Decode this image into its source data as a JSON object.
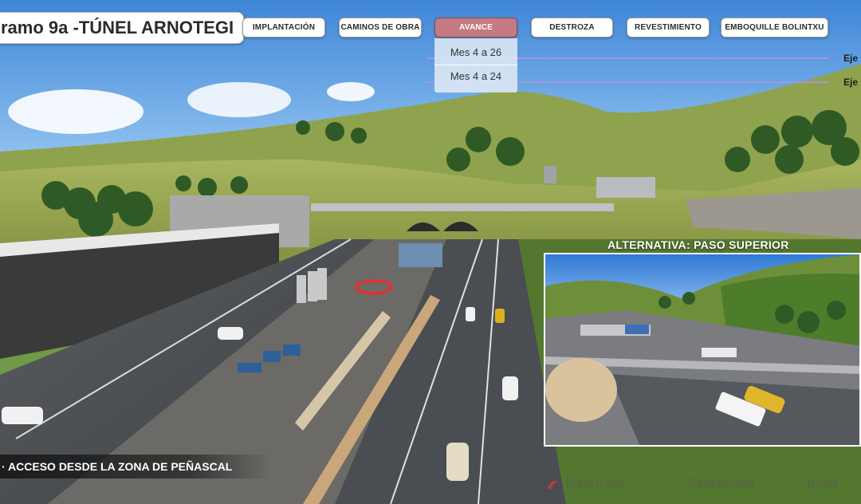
{
  "title": "ramo 9a -TÚNEL ARNOTEGI",
  "nav": {
    "buttons": [
      {
        "label": "IMPLANTACIÓN",
        "active": false
      },
      {
        "label": "CAMINOS DE OBRA",
        "active": false
      },
      {
        "label": "AVANCE",
        "active": true
      },
      {
        "label": "DESTROZA",
        "active": false
      },
      {
        "label": "REVESTIMIENTO",
        "active": false
      },
      {
        "label": "EMBOQUILLE BOLINTXU",
        "active": false
      }
    ]
  },
  "dropdown": {
    "items": [
      "Mes 4 a 26",
      "Mes 4 a 24"
    ]
  },
  "eje_labels": [
    "Eje",
    "Eje"
  ],
  "captions": {
    "alternative": "ALTERNATIVA: PASO SUPERIOR",
    "bottom": "· ACCESO DESDE LA ZONA DE PEÑASCAL"
  },
  "logos": {
    "first": "Viaductos",
    "second": "Sastamalta",
    "third": "turpe"
  },
  "colors": {
    "active_button": "#c47b82",
    "eje_line": "#aa96dc",
    "caption_bg": "#141414"
  },
  "icons": {
    "logo_mark": "red-swirl-logo-icon"
  }
}
